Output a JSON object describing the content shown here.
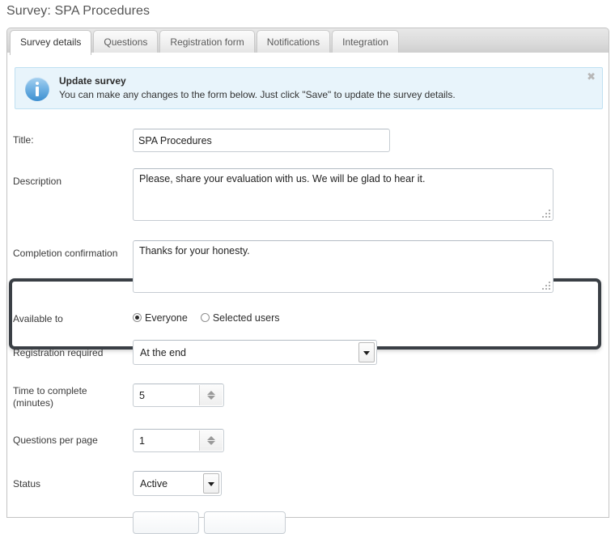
{
  "page": {
    "title": "Survey: SPA Procedures"
  },
  "tabs": [
    {
      "label": "Survey details",
      "active": true
    },
    {
      "label": "Questions",
      "active": false
    },
    {
      "label": "Registration form",
      "active": false
    },
    {
      "label": "Notifications",
      "active": false
    },
    {
      "label": "Integration",
      "active": false
    }
  ],
  "banner": {
    "icon": "info-icon",
    "title": "Update survey",
    "text": "You can make any changes to the form below. Just click \"Save\" to update the survey details.",
    "close_label": "✖",
    "background_color": "#e8f4fb",
    "border_color": "#bfe0f2"
  },
  "form": {
    "title": {
      "label": "Title:",
      "value": "SPA Procedures"
    },
    "description": {
      "label": "Description",
      "value": "Please, share your evaluation with us. We will be glad to hear it."
    },
    "completion_confirmation": {
      "label": "Completion confirmation",
      "value": "Thanks for your honesty.",
      "highlighted": true,
      "highlight_color": "#3a3f45"
    },
    "available_to": {
      "label": "Available to",
      "options": [
        {
          "label": "Everyone",
          "selected": true
        },
        {
          "label": "Selected users",
          "selected": false
        }
      ]
    },
    "registration_required": {
      "label": "Registration required",
      "value": "At the end"
    },
    "time_to_complete": {
      "label": "Time to complete (minutes)",
      "label_line1": "Time to complete",
      "label_line2": "(minutes)",
      "value": "5"
    },
    "questions_per_page": {
      "label": "Questions per page",
      "value": "1"
    },
    "status": {
      "label": "Status",
      "value": "Active"
    }
  },
  "footer": {
    "primary_button": "",
    "secondary_button": ""
  }
}
